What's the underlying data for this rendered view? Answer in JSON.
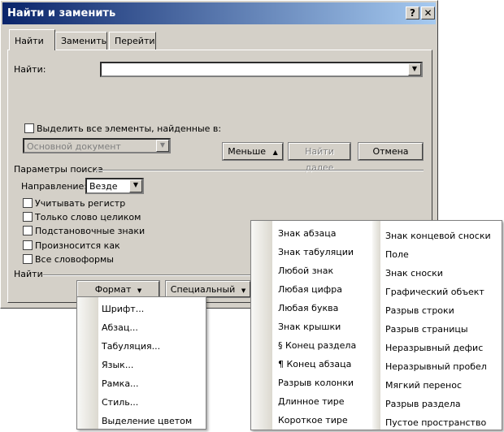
{
  "window": {
    "title": "Найти и заменить",
    "help_button": "?",
    "close_button": "✕"
  },
  "tabs": [
    {
      "label": "Найти",
      "active": true
    },
    {
      "label": "Заменить",
      "active": false
    },
    {
      "label": "Перейти",
      "active": false
    }
  ],
  "find": {
    "label": "Найти:",
    "value": ""
  },
  "highlight_all": {
    "label": "Выделить все элементы, найденные в:",
    "checked": false
  },
  "scope_select": {
    "value": "Основной документ"
  },
  "buttons": {
    "less": "Меньше",
    "less_arrow": "▲",
    "find_next": "Найти далее",
    "cancel": "Отмена",
    "format": "Формат",
    "special": "Специальный",
    "dropdown_arrow": "▼"
  },
  "search_options": {
    "group_label": "Параметры поиска",
    "direction_label": "Направление:",
    "direction_value": "Везде",
    "checkboxes": [
      {
        "label": "Учитывать регистр",
        "checked": false
      },
      {
        "label": "Только слово целиком",
        "checked": false
      },
      {
        "label": "Подстановочные знаки",
        "checked": false
      },
      {
        "label": "Произносится как",
        "checked": false
      },
      {
        "label": "Все словоформы",
        "checked": false
      }
    ]
  },
  "find_group_label": "Найти",
  "format_menu": [
    "Шрифт...",
    "Абзац...",
    "Табуляция...",
    "Язык...",
    "Рамка...",
    "Стиль...",
    "Выделение цветом"
  ],
  "special_menu_col1": [
    "Знак абзаца",
    "Знак табуляции",
    "Любой знак",
    "Любая цифра",
    "Любая буква",
    "Знак крышки",
    "§ Конец раздела",
    "¶ Конец абзаца",
    "Разрыв колонки",
    "Длинное тире",
    "Короткое тире"
  ],
  "special_menu_col2": [
    "Знак концевой сноски",
    "Поле",
    "Знак сноски",
    "Графический объект",
    "Разрыв строки",
    "Разрыв страницы",
    "Неразрывный дефис",
    "Неразрывный пробел",
    "Мягкий перенос",
    "Разрыв раздела",
    "Пустое пространство"
  ]
}
